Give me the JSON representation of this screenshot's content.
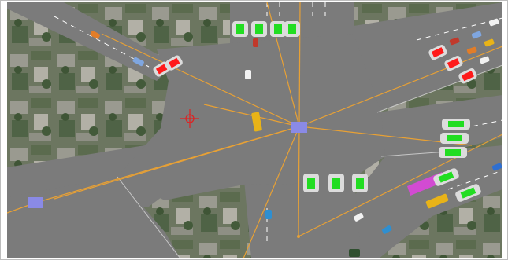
{
  "app": {
    "view": "intersection-traffic-simulation"
  },
  "colors": {
    "road": "#7b7b7b",
    "lane_marking": "#ffffff",
    "guide_line": "#e8a135",
    "signal_green": "#22dd22",
    "signal_red": "#ff1a1a",
    "node_marker": "#8a8ae6",
    "pedestrian_zone": "#d24bd2",
    "crosshair": "#e02020",
    "vehicle_yellow": "#e8b318"
  },
  "icons": {
    "intersection_center": "node-square-icon",
    "west_endpoint": "node-square-icon",
    "origin_marker": "crosshair-icon"
  },
  "signal_groups": [
    {
      "approach": "north",
      "state": "green",
      "count": 4
    },
    {
      "approach": "northwest",
      "state": "red",
      "count": 2
    },
    {
      "approach": "northeast",
      "state": "red",
      "count": 3
    },
    {
      "approach": "east",
      "state": "green",
      "count": 3
    },
    {
      "approach": "south",
      "state": "green",
      "count": 3
    },
    {
      "approach": "southeast",
      "state": "green",
      "count": 2
    }
  ]
}
